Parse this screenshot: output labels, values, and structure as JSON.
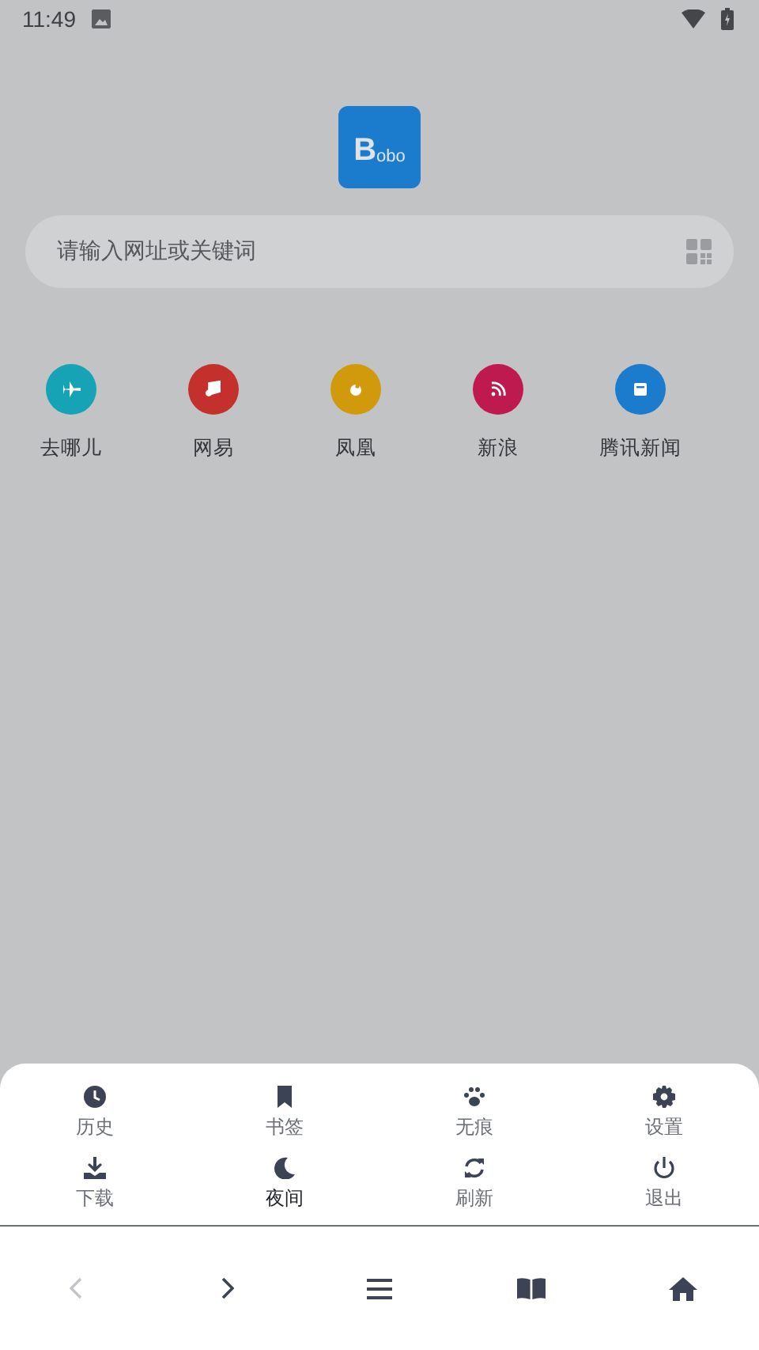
{
  "status_bar": {
    "time": "11:49"
  },
  "logo": {
    "initial": "B",
    "rest": "obo"
  },
  "search": {
    "placeholder": "请输入网址或关键词"
  },
  "shortcuts": [
    {
      "label": "去哪儿",
      "color": "#16a3b5"
    },
    {
      "label": "网易",
      "color": "#c4302c"
    },
    {
      "label": "凤凰",
      "color": "#d09a0c"
    },
    {
      "label": "新浪",
      "color": "#bf1a50"
    },
    {
      "label": "腾讯新闻",
      "color": "#1b7bcc"
    }
  ],
  "menu": [
    {
      "label": "历史",
      "active": false
    },
    {
      "label": "书签",
      "active": false
    },
    {
      "label": "无痕",
      "active": false
    },
    {
      "label": "设置",
      "active": false
    },
    {
      "label": "下载",
      "active": false
    },
    {
      "label": "夜间",
      "active": true
    },
    {
      "label": "刷新",
      "active": false
    },
    {
      "label": "退出",
      "active": false
    }
  ],
  "nav": {
    "back": {
      "disabled": true
    },
    "forward": {
      "disabled": false
    }
  }
}
